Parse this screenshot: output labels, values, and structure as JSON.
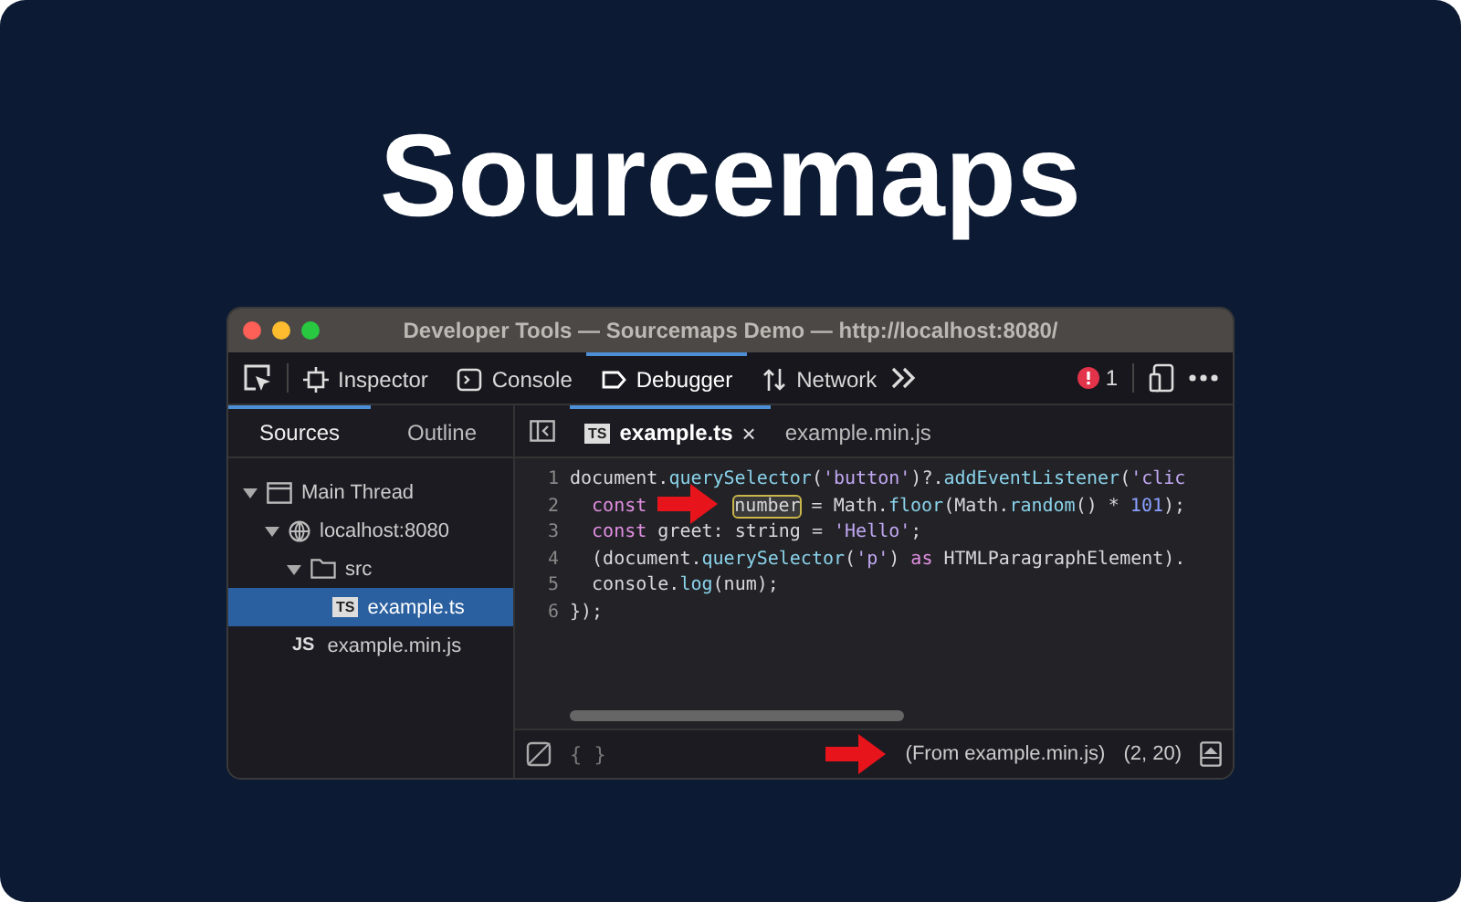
{
  "heading": "Sourcemaps",
  "window": {
    "title": "Developer Tools — Sourcemaps Demo — http://localhost:8080/"
  },
  "toolbar": {
    "tabs": [
      {
        "label": "Inspector",
        "selected": false
      },
      {
        "label": "Console",
        "selected": false
      },
      {
        "label": "Debugger",
        "selected": true
      },
      {
        "label": "Network",
        "selected": false
      }
    ],
    "error_count": "1"
  },
  "side_tabs": [
    {
      "label": "Sources",
      "selected": true
    },
    {
      "label": "Outline",
      "selected": false
    }
  ],
  "tree": [
    {
      "label": "Main Thread",
      "kind": "thread",
      "expanded": true,
      "selected": false,
      "children": [
        {
          "label": "localhost:8080",
          "kind": "host",
          "expanded": true,
          "selected": false,
          "children": [
            {
              "label": "src",
              "kind": "folder",
              "expanded": true,
              "selected": false,
              "children": [
                {
                  "label": "example.ts",
                  "kind": "file",
                  "badge": "TS",
                  "selected": true
                }
              ]
            }
          ]
        },
        {
          "label": "example.min.js",
          "kind": "file",
          "badge": "JS",
          "selected": false
        }
      ]
    }
  ],
  "editor_tabs": [
    {
      "label": "example.ts",
      "badge": "TS",
      "selected": true,
      "close": "×"
    },
    {
      "label": "example.min.js",
      "selected": false
    }
  ],
  "code": [
    {
      "number": "1",
      "tokens": [
        {
          "text": "document.",
          "kind": "plain"
        },
        {
          "text": "querySelector",
          "kind": "func"
        },
        {
          "text": "(",
          "kind": "plain"
        },
        {
          "text": "'button'",
          "kind": "string"
        },
        {
          "text": ")?.",
          "kind": "plain"
        },
        {
          "text": "addEventListener",
          "kind": "func"
        },
        {
          "text": "(",
          "kind": "plain"
        },
        {
          "text": "'clic",
          "kind": "string"
        }
      ]
    },
    {
      "number": "2",
      "tokens": [
        {
          "text": "  const",
          "kind": "keyword"
        },
        {
          "text": "number",
          "kind": "highlight"
        },
        {
          "text": " = Math.",
          "kind": "plain"
        },
        {
          "text": "floor",
          "kind": "func"
        },
        {
          "text": "(Math.",
          "kind": "plain"
        },
        {
          "text": "random",
          "kind": "func"
        },
        {
          "text": "() * ",
          "kind": "plain"
        },
        {
          "text": "101",
          "kind": "number"
        },
        {
          "text": ");",
          "kind": "plain"
        }
      ]
    },
    {
      "number": "3",
      "tokens": [
        {
          "text": "  const",
          "kind": "keyword"
        },
        {
          "text": " greet: string = ",
          "kind": "plain"
        },
        {
          "text": "'Hello'",
          "kind": "string"
        },
        {
          "text": ";",
          "kind": "plain"
        }
      ]
    },
    {
      "number": "4",
      "tokens": [
        {
          "text": "  (document.",
          "kind": "plain"
        },
        {
          "text": "querySelector",
          "kind": "func"
        },
        {
          "text": "(",
          "kind": "plain"
        },
        {
          "text": "'p'",
          "kind": "string"
        },
        {
          "text": ") ",
          "kind": "plain"
        },
        {
          "text": "as",
          "kind": "keyword"
        },
        {
          "text": " HTMLParagraphElement).",
          "kind": "plain"
        }
      ]
    },
    {
      "number": "5",
      "tokens": [
        {
          "text": "  console.",
          "kind": "plain"
        },
        {
          "text": "log",
          "kind": "func"
        },
        {
          "text": "(num);",
          "kind": "plain"
        }
      ]
    },
    {
      "number": "6",
      "tokens": [
        {
          "text": "});",
          "kind": "plain"
        }
      ]
    }
  ],
  "footer": {
    "pretty_print": "{ }",
    "source": "(From example.min.js)",
    "position": "(2, 20)"
  }
}
